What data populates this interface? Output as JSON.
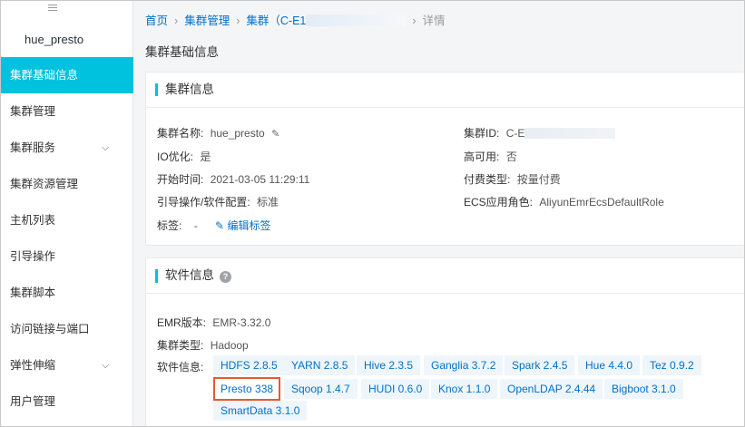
{
  "sidebar": {
    "cluster_name": "hue_presto",
    "items": [
      {
        "label": "集群基础信息",
        "active": true,
        "has_chevron": false
      },
      {
        "label": "集群管理",
        "active": false,
        "has_chevron": false
      },
      {
        "label": "集群服务",
        "active": false,
        "has_chevron": true
      },
      {
        "label": "集群资源管理",
        "active": false,
        "has_chevron": false
      },
      {
        "label": "主机列表",
        "active": false,
        "has_chevron": false
      },
      {
        "label": "引导操作",
        "active": false,
        "has_chevron": false
      },
      {
        "label": "集群脚本",
        "active": false,
        "has_chevron": false
      },
      {
        "label": "访问链接与端口",
        "active": false,
        "has_chevron": false
      },
      {
        "label": "弹性伸缩",
        "active": false,
        "has_chevron": true
      },
      {
        "label": "用户管理",
        "active": false,
        "has_chevron": false
      }
    ]
  },
  "breadcrumb": {
    "home": "首页",
    "cluster_mgmt": "集群管理",
    "cluster_prefix": "集群（C-E1",
    "current": "详情"
  },
  "page_title": "集群基础信息",
  "cluster_info": {
    "title": "集群信息",
    "name_label": "集群名称:",
    "name_value": "hue_presto",
    "io_label": "IO优化:",
    "io_value": "是",
    "start_label": "开始时间:",
    "start_value": "2021-03-05 11:29:11",
    "bootstrap_label": "引导操作/软件配置:",
    "bootstrap_value": "标准",
    "tags_label": "标签:",
    "tags_value": "-",
    "edit_tags": "编辑标签",
    "id_label": "集群ID:",
    "id_value": "C-E",
    "ha_label": "高可用:",
    "ha_value": "否",
    "billing_label": "付费类型:",
    "billing_value": "按量付费",
    "ecs_role_label": "ECS应用角色:",
    "ecs_role_value": "AliyunEmrEcsDefaultRole"
  },
  "software_info": {
    "title": "软件信息",
    "help_icon": "?",
    "emr_label": "EMR版本:",
    "emr_value": "EMR-3.32.0",
    "type_label": "集群类型:",
    "type_value": "Hadoop",
    "software_label": "软件信息:",
    "tags": [
      "HDFS 2.8.5",
      "YARN 2.8.5",
      "Hive 2.3.5",
      "Ganglia 3.7.2",
      "Spark 2.4.5",
      "Hue 4.4.0",
      "Tez 0.9.2",
      "Presto 338",
      "Sqoop 1.4.7",
      "HUDI 0.6.0",
      "Knox 1.1.0",
      "OpenLDAP 2.4.44",
      "Bigboot 3.1.0",
      "SmartData 3.1.0"
    ],
    "highlighted_tag": "Presto 338",
    "highlight_color": "#e35a36"
  },
  "colors": {
    "accent": "#00c1de",
    "link": "#0070cc",
    "tag_bg": "#eef6fb"
  }
}
